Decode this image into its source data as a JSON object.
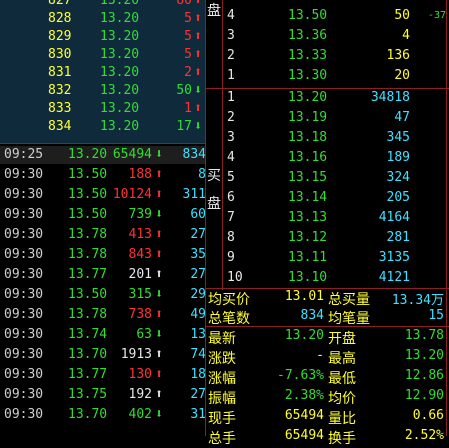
{
  "top_queue": [
    {
      "seq": "827",
      "price": "13.20",
      "vol": "80",
      "dir": "up"
    },
    {
      "seq": "828",
      "price": "13.20",
      "vol": "5",
      "dir": "up"
    },
    {
      "seq": "829",
      "price": "13.20",
      "vol": "5",
      "dir": "up"
    },
    {
      "seq": "830",
      "price": "13.20",
      "vol": "5",
      "dir": "up"
    },
    {
      "seq": "831",
      "price": "13.20",
      "vol": "2",
      "dir": "up"
    },
    {
      "seq": "832",
      "price": "13.20",
      "vol": "50",
      "dir": "down"
    },
    {
      "seq": "833",
      "price": "13.20",
      "vol": "1",
      "dir": "up"
    },
    {
      "seq": "834",
      "price": "13.20",
      "vol": "17",
      "dir": "down"
    }
  ],
  "trades": [
    {
      "time": "09:25",
      "price": "13.20",
      "vol": "65494",
      "dir": "down",
      "num": "834"
    },
    {
      "time": "09:30",
      "price": "13.50",
      "vol": "188",
      "dir": "up",
      "num": "8"
    },
    {
      "time": "09:30",
      "price": "13.50",
      "vol": "10124",
      "dir": "up",
      "num": "311"
    },
    {
      "time": "09:30",
      "price": "13.50",
      "vol": "739",
      "dir": "down",
      "num": "60"
    },
    {
      "time": "09:30",
      "price": "13.78",
      "vol": "413",
      "dir": "up",
      "num": "27"
    },
    {
      "time": "09:30",
      "price": "13.78",
      "vol": "843",
      "dir": "up",
      "num": "35"
    },
    {
      "time": "09:30",
      "price": "13.77",
      "vol": "201",
      "dir": "neutral",
      "num": "27"
    },
    {
      "time": "09:30",
      "price": "13.50",
      "vol": "315",
      "dir": "down",
      "num": "29"
    },
    {
      "time": "09:30",
      "price": "13.78",
      "vol": "738",
      "dir": "up",
      "num": "49"
    },
    {
      "time": "09:30",
      "price": "13.74",
      "vol": "63",
      "dir": "down",
      "num": "13"
    },
    {
      "time": "09:30",
      "price": "13.70",
      "vol": "1913",
      "dir": "neutral",
      "num": "74"
    },
    {
      "time": "09:30",
      "price": "13.77",
      "vol": "130",
      "dir": "up",
      "num": "18"
    },
    {
      "time": "09:30",
      "price": "13.75",
      "vol": "192",
      "dir": "neutral",
      "num": "27"
    },
    {
      "time": "09:30",
      "price": "13.70",
      "vol": "402",
      "dir": "down",
      "num": "31"
    }
  ],
  "sell_side": {
    "label": "盘",
    "rows": [
      {
        "idx": "4",
        "price": "13.50",
        "vol": "50",
        "chg": "-37"
      },
      {
        "idx": "3",
        "price": "13.36",
        "vol": "4",
        "chg": ""
      },
      {
        "idx": "2",
        "price": "13.33",
        "vol": "136",
        "chg": ""
      },
      {
        "idx": "1",
        "price": "13.30",
        "vol": "20",
        "chg": ""
      }
    ]
  },
  "buy_side": {
    "label_top": "买",
    "label_bottom": "盘",
    "rows": [
      {
        "idx": "1",
        "price": "13.20",
        "vol": "34818"
      },
      {
        "idx": "2",
        "price": "13.19",
        "vol": "47"
      },
      {
        "idx": "3",
        "price": "13.18",
        "vol": "345"
      },
      {
        "idx": "4",
        "price": "13.16",
        "vol": "189"
      },
      {
        "idx": "5",
        "price": "13.15",
        "vol": "324"
      },
      {
        "idx": "6",
        "price": "13.14",
        "vol": "205"
      },
      {
        "idx": "7",
        "price": "13.13",
        "vol": "4164"
      },
      {
        "idx": "8",
        "price": "13.12",
        "vol": "281"
      },
      {
        "idx": "9",
        "price": "13.11",
        "vol": "3135"
      },
      {
        "idx": "10",
        "price": "13.10",
        "vol": "4121"
      }
    ]
  },
  "summary": {
    "avg_buy_label": "均买价",
    "avg_buy": "13.01",
    "total_buy_label": "总买量",
    "total_buy": "13.34万",
    "total_trades_label": "总笔数",
    "total_trades": "834",
    "avg_trade_label": "均笔量",
    "avg_trade": "15"
  },
  "quote": {
    "latest_label": "最新",
    "latest": "13.20",
    "open_label": "开盘",
    "open": "13.78",
    "change_label": "涨跌",
    "change": "-",
    "high_label": "最高",
    "high": "13.20",
    "pct_label": "涨幅",
    "pct": "-7.63%",
    "low_label": "最低",
    "low": "12.86",
    "amp_label": "振幅",
    "amp": "2.38%",
    "avg_label": "均价",
    "avg": "12.90",
    "hand_label": "现手",
    "hand": "65494",
    "ratio_label": "量比",
    "ratio": "0.66",
    "total_label": "总手",
    "total": "65494",
    "turnover_label": "换手",
    "turnover": "2.52%"
  },
  "arrows": {
    "up": "🡅",
    "down": "🡇",
    "neutral": "🡅"
  }
}
